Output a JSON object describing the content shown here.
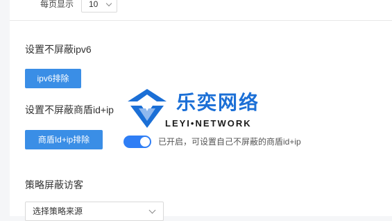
{
  "pagination": {
    "label": "每页显示",
    "page_size": "10"
  },
  "ipv6_section": {
    "title": "设置不屏蔽ipv6",
    "button": "ipv6排除"
  },
  "shield_section": {
    "title": "设置不屏蔽商盾id+ip",
    "button": "商盾Id+ip排除",
    "toggle_on": true,
    "toggle_text": "已开启，可设置自己不屏蔽的商盾id+ip"
  },
  "strategy_section": {
    "title": "策略屏蔽访客",
    "select_value": "选择策略来源"
  },
  "watermark": {
    "main": "乐奕网络",
    "sub": "LEYI•NETWORK"
  },
  "colors": {
    "primary": "#3a8ee6",
    "toggle": "#2f7ef5",
    "brand": "#1b6fd6"
  }
}
